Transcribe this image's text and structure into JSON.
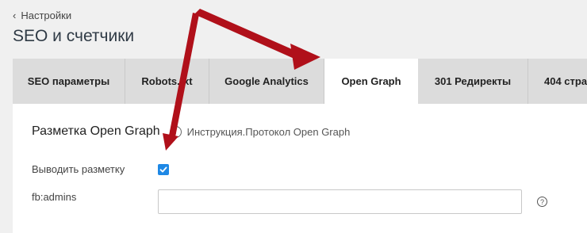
{
  "header": {
    "back_label": "Настройки",
    "page_title": "SEO и счетчики"
  },
  "tabs": [
    {
      "label": "SEO параметры",
      "active": false
    },
    {
      "label": "Robots.txt",
      "active": false
    },
    {
      "label": "Google Analytics",
      "active": false
    },
    {
      "label": "Open Graph",
      "active": true
    },
    {
      "label": "301 Редиректы",
      "active": false
    },
    {
      "label": "404 стра",
      "active": false
    }
  ],
  "panel": {
    "title": "Разметка Open Graph",
    "info_link": "Инструкция.Протокол Open Graph",
    "show_markup_label": "Выводить разметку",
    "show_markup_checked": true,
    "fb_admins_label": "fb:admins",
    "fb_admins_value": ""
  },
  "colors": {
    "accent": "#1e88e5",
    "annotation_arrow": "#b0101a"
  }
}
